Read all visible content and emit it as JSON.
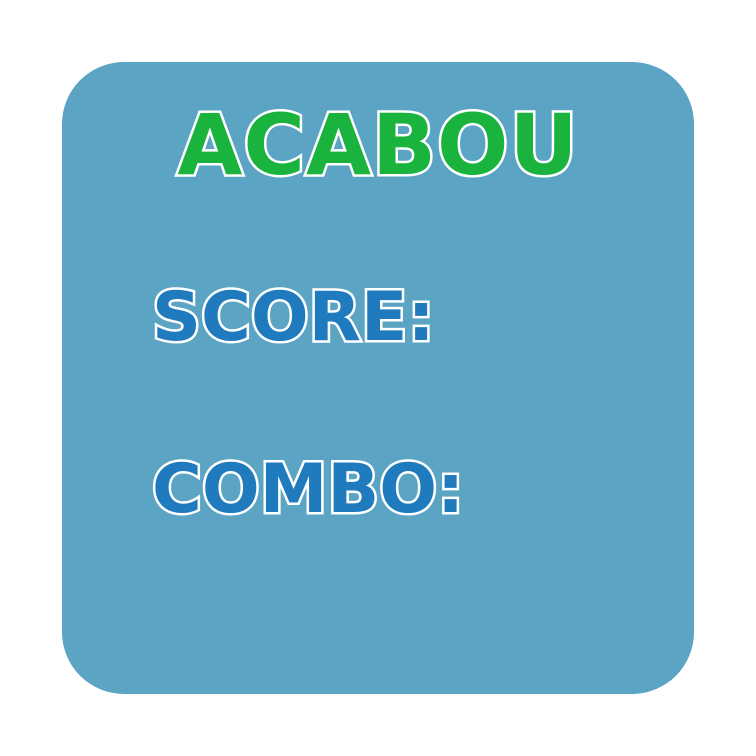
{
  "game_over": {
    "title": "ACABOU",
    "score_label": "SCORE:",
    "combo_label": "COMBO:"
  },
  "colors": {
    "panel": "#5ba4c4",
    "title": "#19b33e",
    "labels": "#1f7bbd",
    "outline": "#ffffff"
  }
}
